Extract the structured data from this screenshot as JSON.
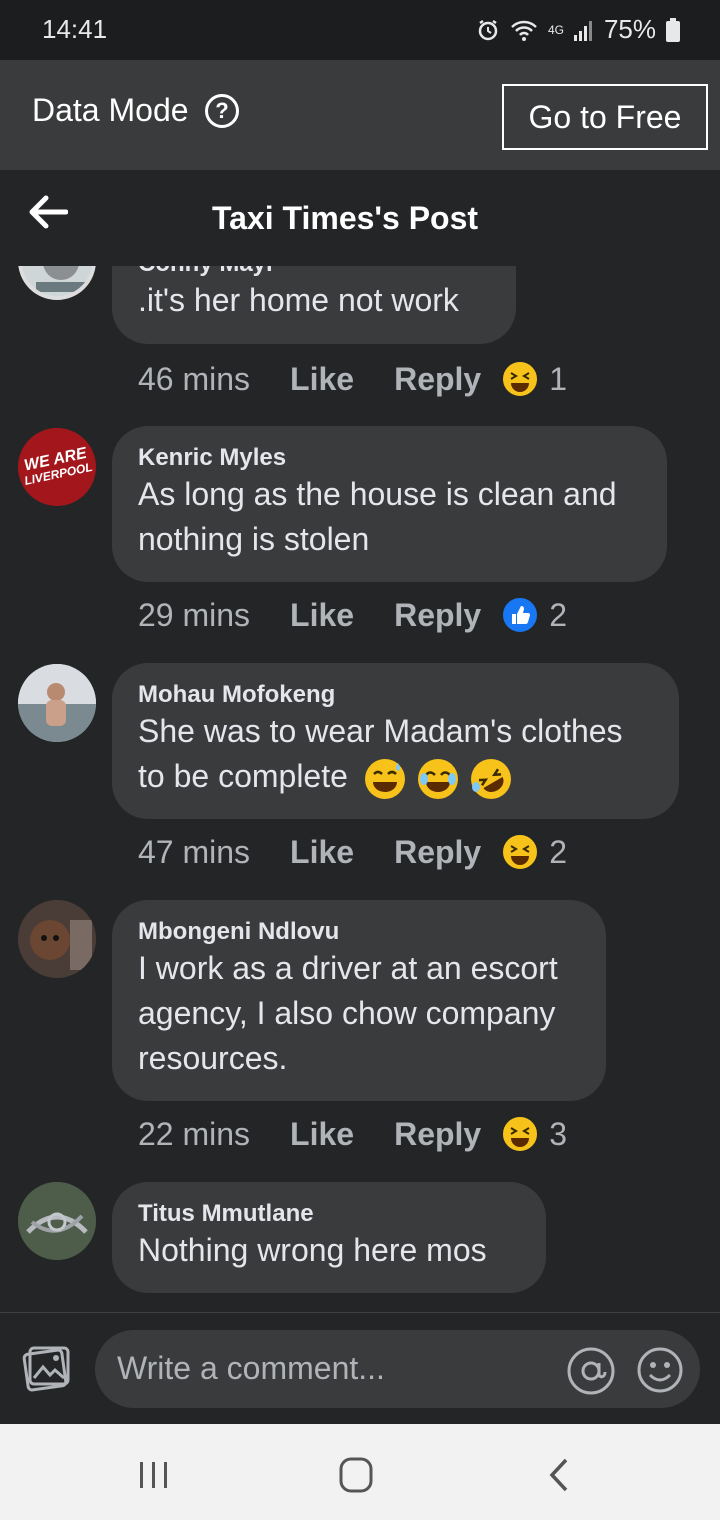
{
  "status_bar": {
    "time": "14:41",
    "network": "4G",
    "battery": "75%"
  },
  "data_mode": {
    "label": "Data Mode",
    "help_icon": "?",
    "go_free_label": "Go to Free"
  },
  "header": {
    "title": "Taxi Times's Post"
  },
  "comments": [
    {
      "author": "Conny Mayi",
      "lines": [
        ".it's her home not work"
      ],
      "time": "46 mins",
      "reaction": "haha",
      "count": "1"
    },
    {
      "author": "Kenric Myles",
      "lines": [
        "As long as the house is clean and",
        "nothing is stolen"
      ],
      "time": "29 mins",
      "reaction": "like",
      "count": "2",
      "avatar_text": [
        "WE ARE",
        "LIVERPOOL"
      ]
    },
    {
      "author": "Mohau Mofokeng",
      "lines": [
        "She was to wear Madam's clothes",
        "to be complete"
      ],
      "time": "47 mins",
      "reaction": "haha",
      "count": "2"
    },
    {
      "author": "Mbongeni Ndlovu",
      "lines": [
        "I work as a driver at an escort",
        "agency, I also chow company",
        "resources."
      ],
      "time": "22 mins",
      "reaction": "haha",
      "count": "3"
    },
    {
      "author": "Titus Mmutlane",
      "lines": [
        "Nothing wrong here mos"
      ]
    }
  ],
  "actions": {
    "like": "Like",
    "reply": "Reply"
  },
  "composer": {
    "placeholder": "Write a comment..."
  },
  "colors": {
    "background": "#242526",
    "bubble": "#3a3b3c",
    "data_bar": "#3a3b3c",
    "like_blue": "#1877f2",
    "haha_yellow": "#f7c21a"
  }
}
